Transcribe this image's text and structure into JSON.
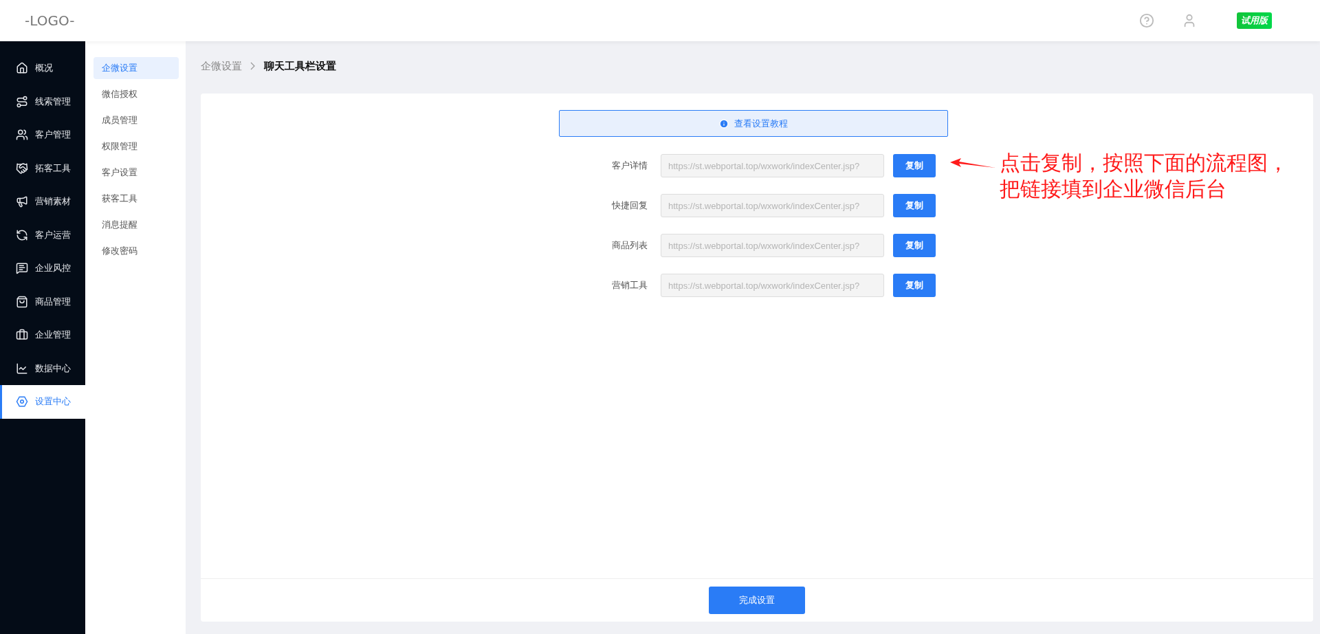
{
  "header": {
    "logo": "-LOGO-",
    "badge": "试用版"
  },
  "sidebar": {
    "items": [
      {
        "label": "概况",
        "selected": false
      },
      {
        "label": "线索管理",
        "selected": false
      },
      {
        "label": "客户管理",
        "selected": false
      },
      {
        "label": "拓客工具",
        "selected": false
      },
      {
        "label": "营销素材",
        "selected": false
      },
      {
        "label": "客户运营",
        "selected": false
      },
      {
        "label": "企业风控",
        "selected": false
      },
      {
        "label": "商品管理",
        "selected": false
      },
      {
        "label": "企业管理",
        "selected": false
      },
      {
        "label": "数据中心",
        "selected": false
      },
      {
        "label": "设置中心",
        "selected": true
      }
    ]
  },
  "submenu": {
    "items": [
      {
        "label": "企微设置",
        "selected": true
      },
      {
        "label": "微信授权",
        "selected": false
      },
      {
        "label": "成员管理",
        "selected": false
      },
      {
        "label": "权限管理",
        "selected": false
      },
      {
        "label": "客户设置",
        "selected": false
      },
      {
        "label": "获客工具",
        "selected": false
      },
      {
        "label": "消息提醒",
        "selected": false
      },
      {
        "label": "修改密码",
        "selected": false
      }
    ]
  },
  "breadcrumb": [
    "企微设置",
    "聊天工具栏设置"
  ],
  "tutorial_link": "查看设置教程",
  "rows": [
    {
      "label": "客户详情",
      "placeholder": "https://st.webportal.top/wxwork/indexCenter.jsp?",
      "button": "复制"
    },
    {
      "label": "快捷回复",
      "placeholder": "https://st.webportal.top/wxwork/indexCenter.jsp?",
      "button": "复制"
    },
    {
      "label": "商品列表",
      "placeholder": "https://st.webportal.top/wxwork/indexCenter.jsp?",
      "button": "复制"
    },
    {
      "label": "营销工具",
      "placeholder": "https://st.webportal.top/wxwork/indexCenter.jsp?",
      "button": "复制"
    }
  ],
  "annotation": "点击复制，按照下面的流程图，把链接填到企业微信后台",
  "finish_button": "完成设置"
}
